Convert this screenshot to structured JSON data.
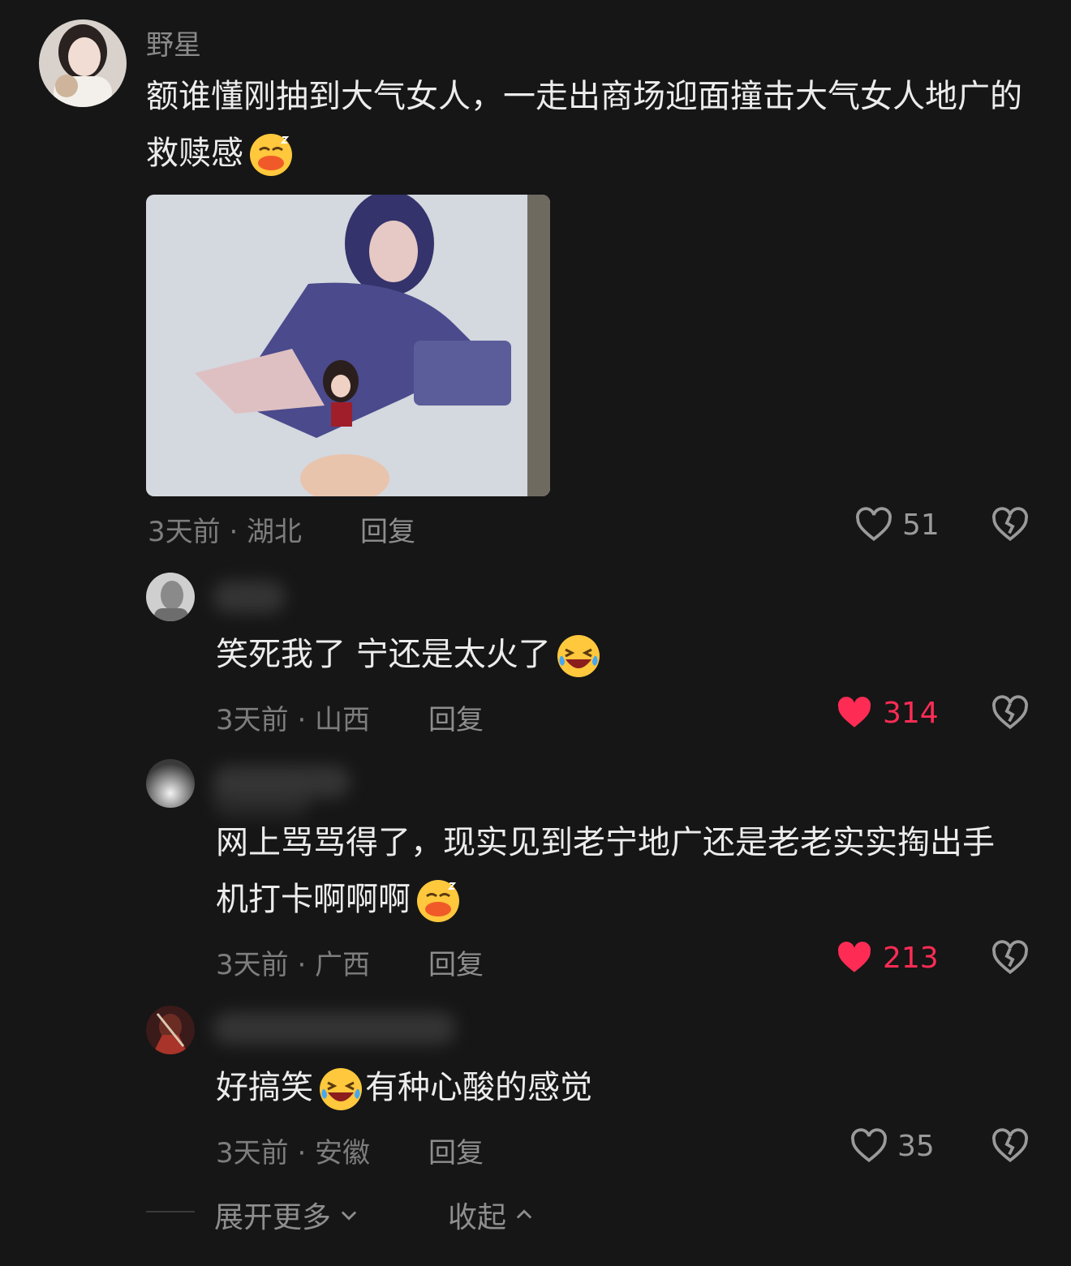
{
  "comments": [
    {
      "username": "野星",
      "text": "额谁懂刚抽到大气女人，一走出商场迎面撞击大气女人地广的救赎感",
      "emoji": "sleeping-duck-emoji",
      "time_location": "3天前 · 湖北",
      "reply_label": "回复",
      "likes": "51",
      "liked": false
    },
    {
      "username": "",
      "text": "笑死我了 宁还是太火了",
      "emoji": "crying-laughing-emoji",
      "time_location": "3天前 · 山西",
      "reply_label": "回复",
      "likes": "314",
      "liked": true
    },
    {
      "username": "",
      "text": "网上骂骂得了，现实见到老宁地广还是老老实实掏出手机打卡啊啊啊",
      "emoji": "sleeping-duck-emoji",
      "time_location": "3天前 · 广西",
      "reply_label": "回复",
      "likes": "213",
      "liked": true
    },
    {
      "username": "",
      "text_before": "好搞笑",
      "emoji": "crying-laughing-emoji",
      "text_after": "有种心酸的感觉",
      "time_location": "3天前 · 安徽",
      "reply_label": "回复",
      "likes": "35",
      "liked": false
    }
  ],
  "footer": {
    "expand_label": "展开更多",
    "collapse_label": "收起"
  },
  "colors": {
    "background": "#161616",
    "liked": "#fe2c55",
    "muted": "#8e8e8e"
  }
}
